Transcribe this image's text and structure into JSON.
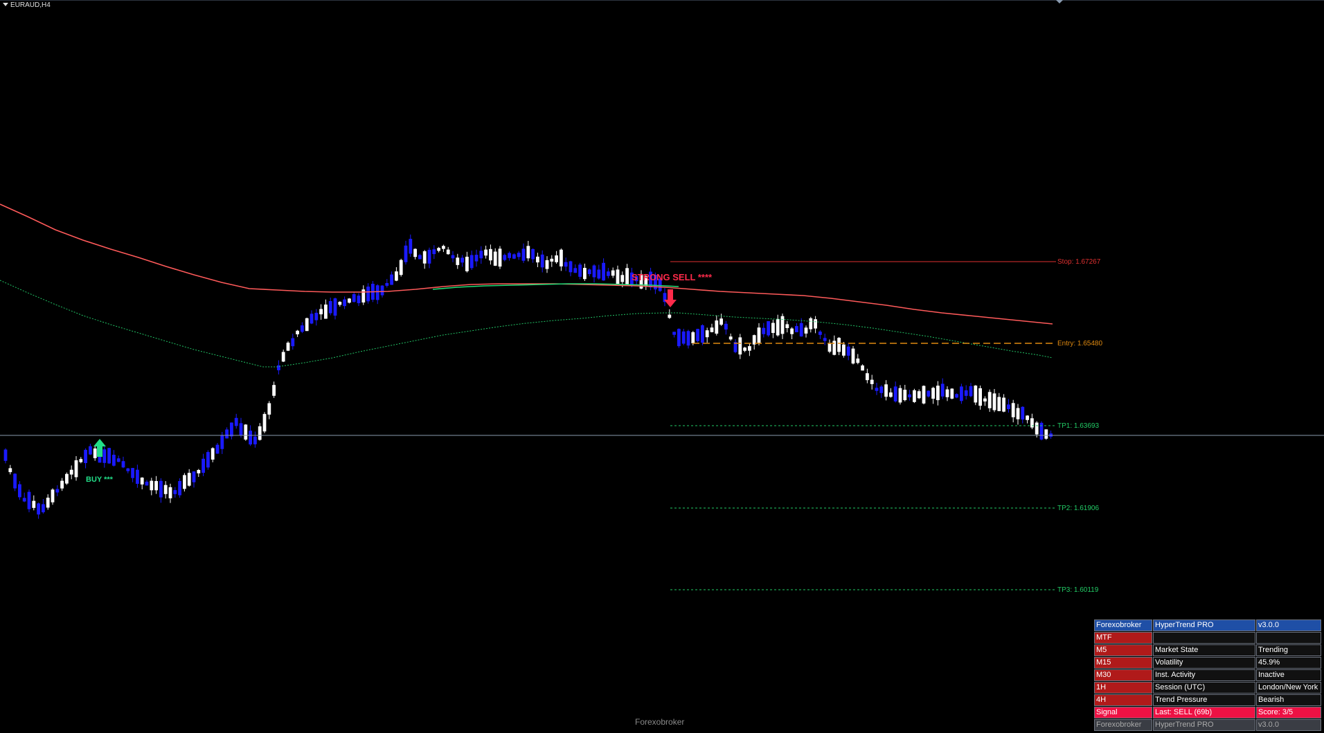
{
  "chart": {
    "title": "EURAUD,H4",
    "watermark": "Forexobroker",
    "colors": {
      "background": "#000000",
      "bull": "#ffffff",
      "bear": "#1a1aff",
      "ma_slow": "#ff5a5a",
      "ma_fast": "#22dd77",
      "ma_dotted": "#22c466",
      "stop": "#e03030",
      "entry": "#e08a10",
      "tp": "#22cc66",
      "strong_sell": "#ff2a4a",
      "buy": "#22dd88"
    },
    "signals": {
      "buy_label": "BUY ***",
      "sell_label": "STRONG SELL ****"
    },
    "levels": {
      "stop": "Stop: 1.67267",
      "entry": "Entry: 1.65480",
      "tp1": "TP1: 1.63693",
      "tp2": "TP2: 1.61906",
      "tp3": "TP3: 1.60119"
    }
  },
  "panel": {
    "rows": [
      [
        "Forexobroker",
        "HyperTrend PRO",
        "v3.0.0"
      ],
      [
        "MTF",
        "",
        ""
      ],
      [
        "M5",
        "Market State",
        "Trending"
      ],
      [
        "M15",
        "Volatility",
        "45.9%"
      ],
      [
        "M30",
        "Inst. Activity",
        "Inactive"
      ],
      [
        "1H",
        "Session (UTC)",
        "London/New York"
      ],
      [
        "4H",
        "Trend Pressure",
        "Bearish"
      ],
      [
        "Signal",
        "Last: SELL (69b)",
        "Score: 3/5"
      ],
      [
        "Forexobroker",
        "HyperTrend PRO",
        "v3.0.0"
      ]
    ]
  }
}
